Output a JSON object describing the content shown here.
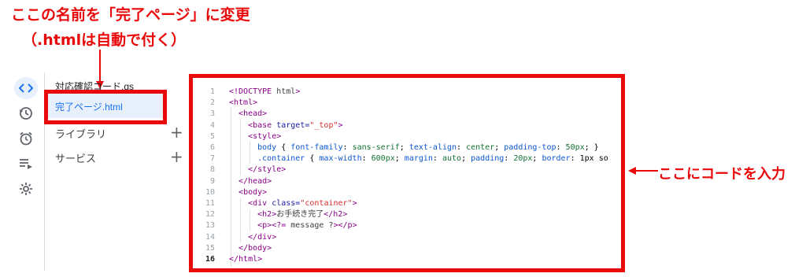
{
  "annotations": {
    "top_line1": "ここの名前を「完了ページ」に変更",
    "top_line2": "（.htmlは自動で付く）",
    "right_label": "ここにコードを入力"
  },
  "rail": {
    "icons": [
      "code-icon",
      "history-icon",
      "alarm-icon",
      "playlist-icon",
      "settings-icon"
    ],
    "active": "code-icon"
  },
  "files": [
    {
      "name": "対応確認コード.gs",
      "active": false
    },
    {
      "name": "完了ページ.html",
      "active": true
    }
  ],
  "sections": [
    {
      "label": "ライブラリ",
      "action": "+"
    },
    {
      "label": "サービス",
      "action": "+"
    }
  ],
  "editor": {
    "current_line": 16,
    "lines": [
      {
        "n": "1",
        "text": "<!DOCTYPE html>"
      },
      {
        "n": "2",
        "text": "<html>"
      },
      {
        "n": "3",
        "text": "  <head>"
      },
      {
        "n": "4",
        "text": "    <base target=\"_top\">"
      },
      {
        "n": "5",
        "text": "    <style>"
      },
      {
        "n": "6",
        "text": "      body { font-family: sans-serif; text-align: center; padding-top: 50px; }"
      },
      {
        "n": "7",
        "text": "      .container { max-width: 600px; margin: auto; padding: 20px; border: 1px so"
      },
      {
        "n": "8",
        "text": "    </style>"
      },
      {
        "n": "9",
        "text": "  </head>"
      },
      {
        "n": "10",
        "text": "  <body>"
      },
      {
        "n": "11",
        "text": "    <div class=\"container\">"
      },
      {
        "n": "12",
        "text": "      <h2>お手続き完了</h2>"
      },
      {
        "n": "13",
        "text": "      <p><?= message ?></p>"
      },
      {
        "n": "14",
        "text": "    </div>"
      },
      {
        "n": "15",
        "text": "  </body>"
      },
      {
        "n": "16",
        "text": "</html>"
      }
    ]
  },
  "colors": {
    "annotation_red": "#e8090b",
    "active_blue": "#1a73e8",
    "active_bg": "#e8f0fe"
  }
}
